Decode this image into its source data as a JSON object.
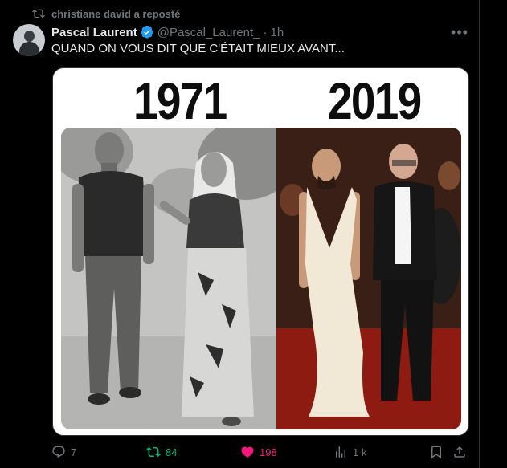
{
  "repost": {
    "text": "christiane david a reposté"
  },
  "tweet": {
    "author": "Pascal Laurent",
    "handle": "@Pascal_Laurent_",
    "separator": "·",
    "time": "1h",
    "text": "QUAND ON VOUS DIT QUE C'ÉTAIT MIEUX AVANT..."
  },
  "media": {
    "year_left": "1971",
    "year_right": "2019"
  },
  "actions": {
    "replies": "7",
    "reposts": "84",
    "likes": "198",
    "views": "1 k"
  },
  "colors": {
    "repost_active": "#00ba7c",
    "like_active": "#f91880",
    "muted": "#71767b",
    "verified": "#1d9bf0"
  },
  "icons": [
    "repost-icon",
    "verified-icon",
    "more-icon",
    "reply-icon",
    "like-icon",
    "views-icon",
    "bookmark-icon",
    "share-icon"
  ]
}
